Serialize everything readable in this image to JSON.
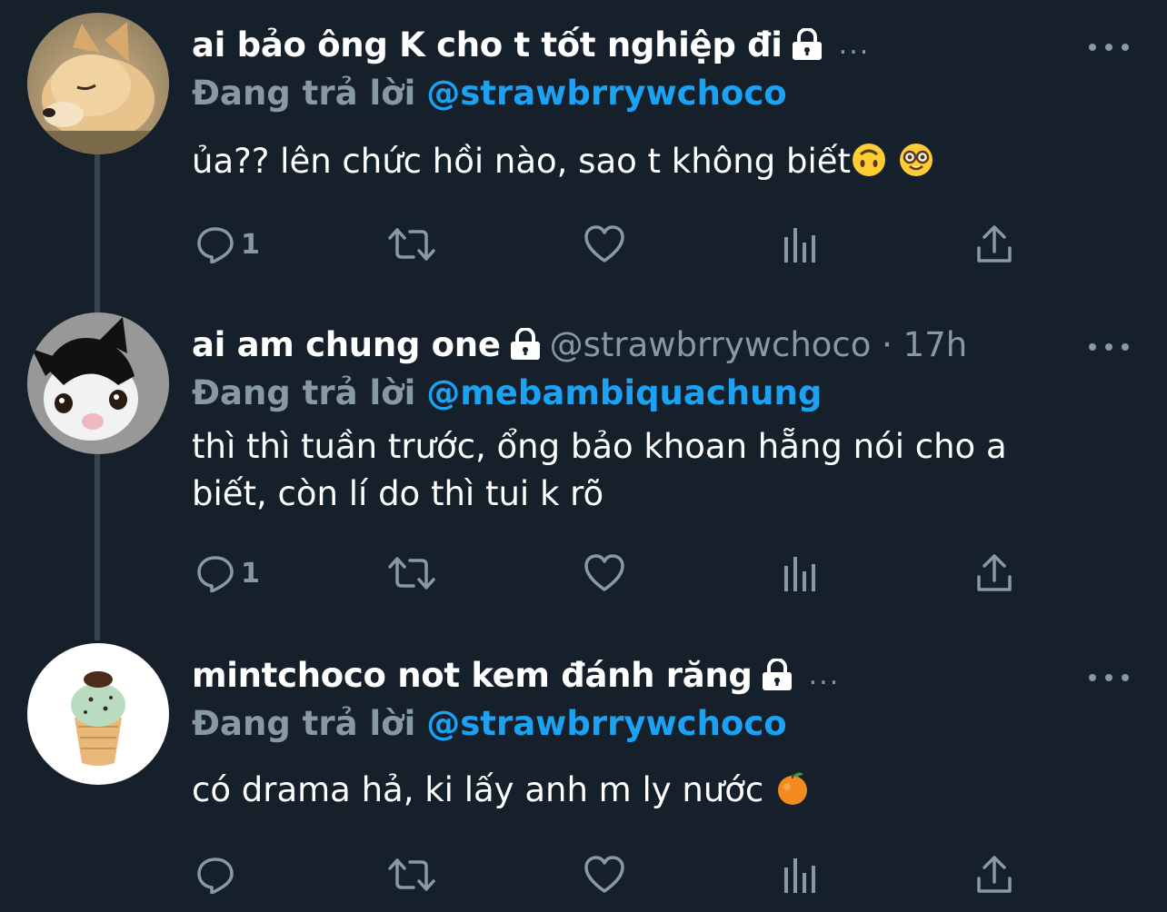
{
  "tweets": [
    {
      "display_name": "ai bảo ông K cho t tốt nghiệp đi",
      "protected": true,
      "handle_time": "",
      "truncated_marker": "...",
      "reply_prefix": "Đang trả lời",
      "reply_to": "@strawbrrywchoco",
      "text": "ủa?? lên chức hồi nào, sao t không biết",
      "emojis": [
        "upside-down-face",
        "nerd-face"
      ],
      "reply_count": "1",
      "avatar": "shiba-dog-avatar"
    },
    {
      "display_name": "ai am chung one",
      "protected": true,
      "handle_time": "@strawbrrywchoco · 17h",
      "truncated_marker": "",
      "reply_prefix": "Đang trả lời",
      "reply_to": "@mebambiquachung",
      "text": "thì thì tuần trước, ổng bảo khoan hẵng nói cho a biết, còn lí do thì tui k rõ",
      "emojis": [],
      "reply_count": "1",
      "avatar": "black-white-kitten-avatar"
    },
    {
      "display_name": "mintchoco not kem đánh răng",
      "protected": true,
      "handle_time": "",
      "truncated_marker": "...",
      "reply_prefix": "Đang trả lời",
      "reply_to": "@strawbrrywchoco",
      "text": "có drama hả, ki lấy anh m ly nước",
      "emojis": [
        "tangerine"
      ],
      "reply_count": "",
      "avatar": "mint-choco-ice-cream-avatar"
    }
  ],
  "colors": {
    "background": "#15202b",
    "text": "#ffffff",
    "muted": "#8899a6",
    "accent": "#1da1f2",
    "thread_line": "#38444d"
  },
  "icons": [
    "reply-icon",
    "retweet-icon",
    "like-icon",
    "analytics-icon",
    "share-icon",
    "more-icon",
    "lock-icon"
  ]
}
